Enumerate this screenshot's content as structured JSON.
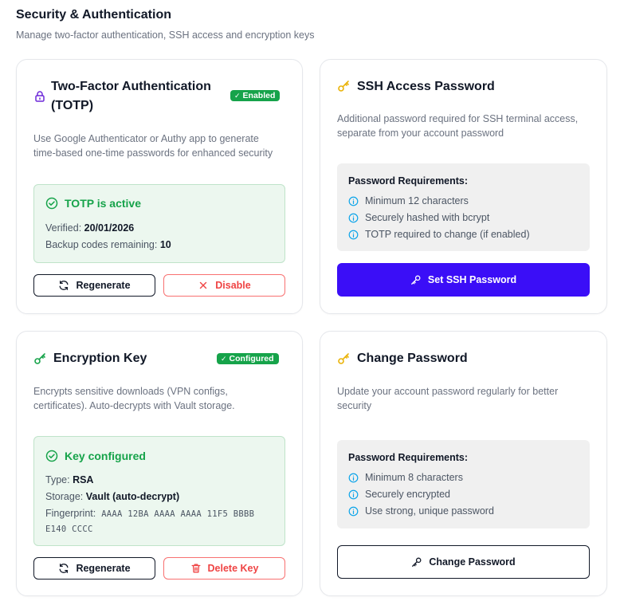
{
  "header": {
    "title": "Security & Authentication",
    "subtitle": "Manage two-factor authentication, SSH access and encryption keys"
  },
  "colors": {
    "success": "#16a34a",
    "danger": "#ef4444",
    "primary": "#3b0ef7",
    "info": "#0ea5e9",
    "key_yellow": "#eab308",
    "lock_purple": "#6d28d9"
  },
  "totp": {
    "icon": "lock-icon",
    "title_line1": "Two-Factor Authentication",
    "title_line2": "(TOTP)",
    "badge": "Enabled",
    "desc_line1": "Use Google Authenticator or Authy app to generate",
    "desc_line2": "time-based one-time passwords for enhanced security",
    "status": "TOTP is active",
    "verified_label": "Verified:",
    "verified_value": "20/01/2026",
    "backup_label": "Backup codes remaining:",
    "backup_value": "10",
    "regenerate_label": "Regenerate",
    "disable_label": "Disable"
  },
  "ssh": {
    "icon": "key-icon",
    "title": "SSH Access Password",
    "desc_line1": "Additional password required for SSH terminal access,",
    "desc_line2": "separate from your account password",
    "req_title": "Password Requirements:",
    "requirements": [
      "Minimum 12 characters",
      "Securely hashed with bcrypt",
      "TOTP required to change (if enabled)"
    ],
    "button_label": "Set SSH Password"
  },
  "encryption": {
    "icon": "key-icon",
    "title": "Encryption Key",
    "badge": "Configured",
    "desc_line1": "Encrypts sensitive downloads (VPN configs,",
    "desc_line2": "certificates). Auto-decrypts with Vault storage.",
    "status": "Key configured",
    "type_label": "Type:",
    "type_value": "RSA",
    "storage_label": "Storage:",
    "storage_value": "Vault (auto-decrypt)",
    "fingerprint_label": "Fingerprint:",
    "fingerprint_line1": "AAAA 12BA AAAA AAAA 11F5 BBBB",
    "fingerprint_line2": "E140 CCCC",
    "regenerate_label": "Regenerate",
    "delete_label": "Delete Key"
  },
  "change_password": {
    "icon": "key-icon",
    "title": "Change Password",
    "desc_line1": "Update your account password regularly for better",
    "desc_line2": "security",
    "req_title": "Password Requirements:",
    "requirements": [
      "Minimum 8 characters",
      "Securely encrypted",
      "Use strong, unique password"
    ],
    "button_label": "Change Password"
  }
}
